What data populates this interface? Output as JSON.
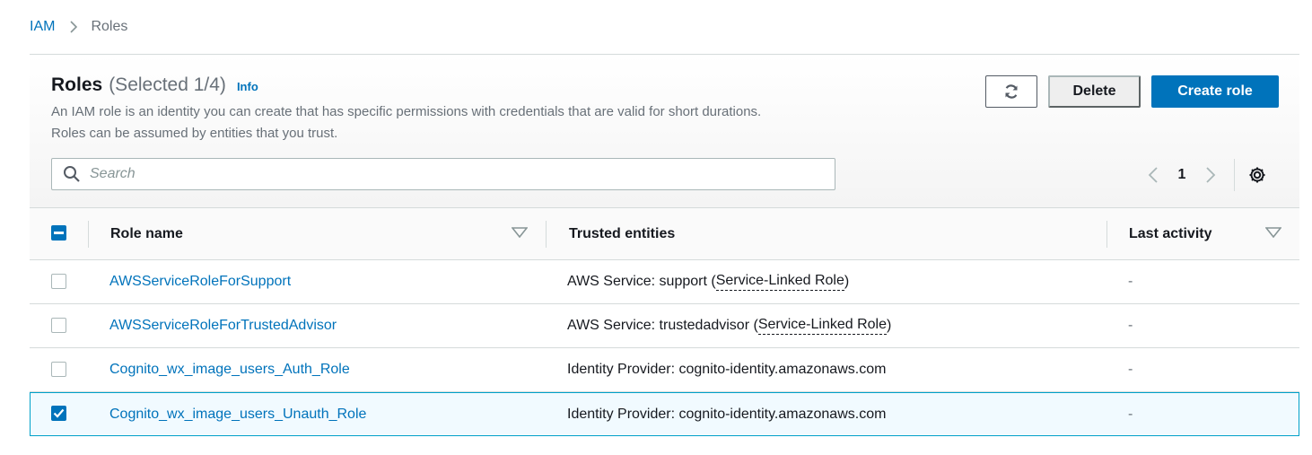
{
  "breadcrumb": {
    "root": "IAM",
    "current": "Roles"
  },
  "header": {
    "title": "Roles",
    "count": "(Selected 1/4)",
    "info": "Info",
    "description_line1": "An IAM role is an identity you can create that has specific permissions with credentials that are valid for short durations.",
    "description_line2": "Roles can be assumed by entities that you trust."
  },
  "actions": {
    "delete_label": "Delete",
    "create_label": "Create role"
  },
  "search": {
    "placeholder": "Search",
    "value": ""
  },
  "pagination": {
    "page": "1"
  },
  "table": {
    "headers": {
      "role_name": "Role name",
      "trusted_entities": "Trusted entities",
      "last_activity": "Last activity"
    },
    "rows": [
      {
        "name": "AWSServiceRoleForSupport",
        "trusted_prefix": "AWS Service: support (",
        "trusted_link": "Service-Linked Role",
        "trusted_suffix": ")",
        "last_activity": "-",
        "selected": false
      },
      {
        "name": "AWSServiceRoleForTrustedAdvisor",
        "trusted_prefix": "AWS Service: trustedadvisor (",
        "trusted_link": "Service-Linked Role",
        "trusted_suffix": ")",
        "last_activity": "-",
        "selected": false
      },
      {
        "name": "Cognito_wx_image_users_Auth_Role",
        "trusted_prefix": "Identity Provider: cognito-identity.amazonaws.com",
        "trusted_link": "",
        "trusted_suffix": "",
        "last_activity": "-",
        "selected": false
      },
      {
        "name": "Cognito_wx_image_users_Unauth_Role",
        "trusted_prefix": "Identity Provider: cognito-identity.amazonaws.com",
        "trusted_link": "",
        "trusted_suffix": "",
        "last_activity": "-",
        "selected": true
      }
    ]
  },
  "colors": {
    "accent": "#0073bb",
    "selected_row_bg": "#f1faff",
    "selected_row_border": "#00a1c9",
    "muted_text": "#687078"
  },
  "icons": {
    "refresh": "refresh-icon",
    "search": "search-icon",
    "settings": "gear-icon",
    "sort": "caret-down-icon",
    "select_all": "indeterminate-checkbox-icon"
  }
}
